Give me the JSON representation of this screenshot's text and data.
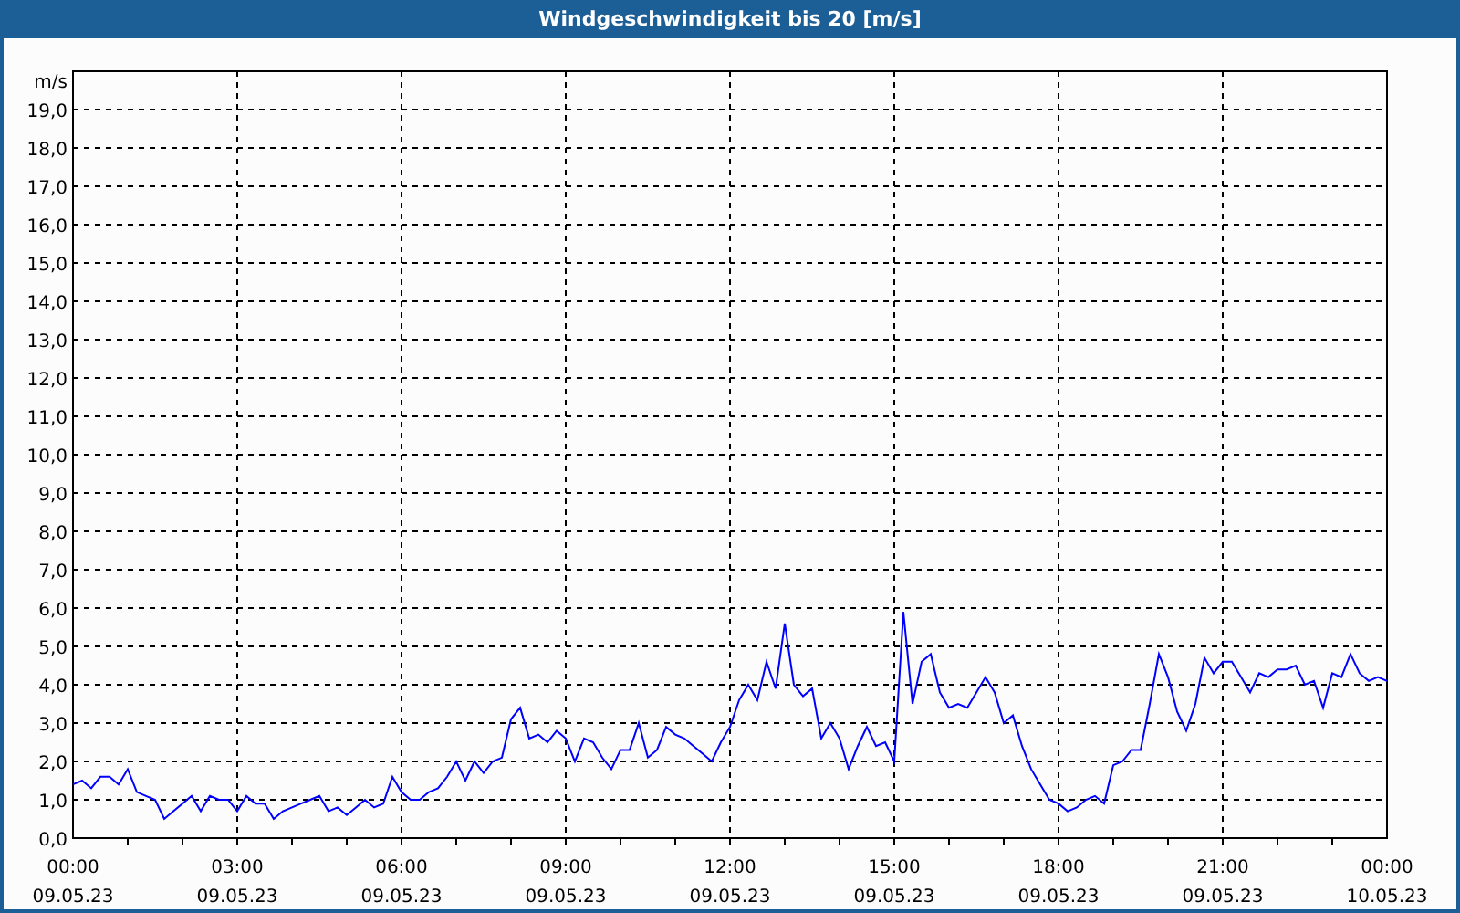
{
  "chart_data": {
    "type": "line",
    "title": "Windgeschwindigkeit bis 20 [m/s]",
    "ylabel": "m/s",
    "categories": [
      "00:00 09.05.23",
      null,
      null,
      null,
      null,
      null,
      null,
      null,
      null,
      null,
      null,
      null,
      null,
      null,
      null,
      null,
      null,
      null,
      "03:00 09.05.23",
      null,
      null,
      null,
      null,
      null,
      null,
      null,
      null,
      null,
      null,
      null,
      null,
      null,
      null,
      null,
      null,
      null,
      "06:00 09.05.23",
      null,
      null,
      null,
      null,
      null,
      null,
      null,
      null,
      null,
      null,
      null,
      null,
      null,
      null,
      null,
      null,
      null,
      "09:00 09.05.23",
      null,
      null,
      null,
      null,
      null,
      null,
      null,
      null,
      null,
      null,
      null,
      null,
      null,
      null,
      null,
      null,
      null,
      "12:00 09.05.23",
      null,
      null,
      null,
      null,
      null,
      null,
      null,
      null,
      null,
      null,
      null,
      null,
      null,
      null,
      null,
      null,
      null,
      "15:00 09.05.23",
      null,
      null,
      null,
      null,
      null,
      null,
      null,
      null,
      null,
      null,
      null,
      null,
      null,
      null,
      null,
      null,
      null,
      "18:00 09.05.23",
      null,
      null,
      null,
      null,
      null,
      null,
      null,
      null,
      null,
      null,
      null,
      null,
      null,
      null,
      null,
      null,
      null,
      "21:00 09.05.23",
      null,
      null,
      null,
      null,
      null,
      null,
      null,
      null,
      null,
      null,
      null,
      null,
      null,
      null,
      null,
      null,
      null,
      "00:00 10.05.23"
    ],
    "series": [
      {
        "color": "#0000ff",
        "values": [
          1.4,
          1.5,
          1.3,
          1.6,
          1.6,
          1.4,
          1.8,
          1.2,
          1.1,
          1.0,
          0.5,
          0.7,
          0.9,
          1.1,
          0.7,
          1.1,
          1.0,
          1.0,
          0.7,
          1.1,
          0.9,
          0.9,
          0.5,
          0.7,
          0.8,
          0.9,
          1.0,
          1.1,
          0.7,
          0.8,
          0.6,
          0.8,
          1.0,
          0.8,
          0.9,
          1.6,
          1.2,
          1.0,
          1.0,
          1.2,
          1.3,
          1.6,
          2.0,
          1.5,
          2.0,
          1.7,
          2.0,
          2.1,
          3.1,
          3.4,
          2.6,
          2.7,
          2.5,
          2.8,
          2.6,
          2.0,
          2.6,
          2.5,
          2.1,
          1.8,
          2.3,
          2.3,
          3.0,
          2.1,
          2.3,
          2.9,
          2.7,
          2.6,
          2.4,
          2.2,
          2.0,
          2.5,
          2.9,
          3.6,
          4.0,
          3.6,
          4.6,
          3.9,
          5.6,
          4.0,
          3.7,
          3.9,
          2.6,
          3.0,
          2.6,
          1.8,
          2.4,
          2.9,
          2.4,
          2.5,
          2.0,
          5.9,
          3.5,
          4.6,
          4.8,
          3.8,
          3.4,
          3.5,
          3.4,
          3.8,
          4.2,
          3.8,
          3.0,
          3.2,
          2.4,
          1.8,
          1.4,
          1.0,
          0.9,
          0.7,
          0.8,
          1.0,
          1.1,
          0.9,
          1.9,
          2.0,
          2.3,
          2.3,
          3.5,
          4.8,
          4.2,
          3.3,
          2.8,
          3.5,
          4.7,
          4.3,
          4.6,
          4.6,
          4.2,
          3.8,
          4.3,
          4.2,
          4.4,
          4.4,
          4.5,
          4.0,
          4.1,
          3.4,
          4.3,
          4.2,
          4.8,
          4.3,
          4.1,
          4.2,
          4.1
        ]
      }
    ],
    "ylim": [
      0,
      20
    ],
    "grid": true,
    "yticks": [
      {
        "value": 0,
        "label": "0,0"
      },
      {
        "value": 1,
        "label": "1,0"
      },
      {
        "value": 2,
        "label": "2,0"
      },
      {
        "value": 3,
        "label": "3,0"
      },
      {
        "value": 4,
        "label": "4,0"
      },
      {
        "value": 5,
        "label": "5,0"
      },
      {
        "value": 6,
        "label": "6,0"
      },
      {
        "value": 7,
        "label": "7,0"
      },
      {
        "value": 8,
        "label": "8,0"
      },
      {
        "value": 9,
        "label": "9,0"
      },
      {
        "value": 10,
        "label": "10,0"
      },
      {
        "value": 11,
        "label": "11,0"
      },
      {
        "value": 12,
        "label": "12,0"
      },
      {
        "value": 13,
        "label": "13,0"
      },
      {
        "value": 14,
        "label": "14,0"
      },
      {
        "value": 15,
        "label": "15,0"
      },
      {
        "value": 16,
        "label": "16,0"
      },
      {
        "value": 17,
        "label": "17,0"
      },
      {
        "value": 18,
        "label": "18,0"
      },
      {
        "value": 19,
        "label": "19,0"
      }
    ]
  }
}
